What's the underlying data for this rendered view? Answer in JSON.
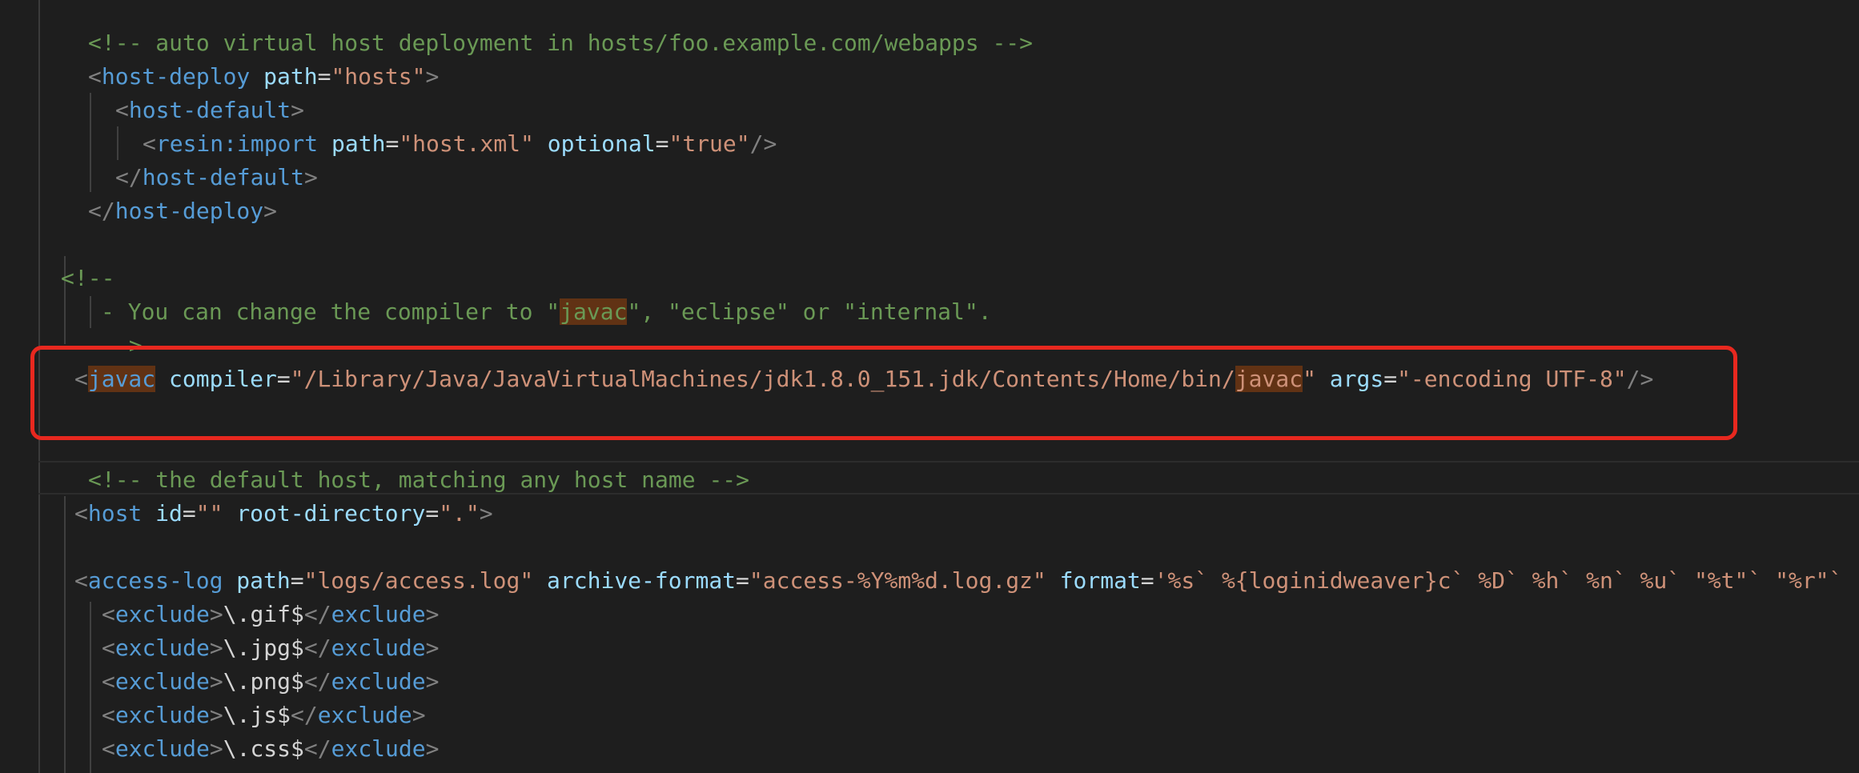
{
  "editor": {
    "lines": [
      {
        "id": "l1",
        "segments": [
          {
            "cls": "t-comment",
            "text": "<!-- auto virtual host deployment in hosts/foo.example.com/webapps -->"
          }
        ]
      },
      {
        "id": "l2",
        "segments": [
          {
            "cls": "t-bracket",
            "text": "<"
          },
          {
            "cls": "t-tag",
            "text": "host-deploy"
          },
          {
            "cls": "t-text",
            "text": " "
          },
          {
            "cls": "t-attr",
            "text": "path"
          },
          {
            "cls": "t-text",
            "text": "="
          },
          {
            "cls": "t-str",
            "text": "\"hosts\""
          },
          {
            "cls": "t-bracket",
            "text": ">"
          }
        ]
      },
      {
        "id": "l3",
        "segments": [
          {
            "cls": "t-bracket",
            "text": "<"
          },
          {
            "cls": "t-tag",
            "text": "host-default"
          },
          {
            "cls": "t-bracket",
            "text": ">"
          }
        ]
      },
      {
        "id": "l4",
        "segments": [
          {
            "cls": "t-bracket",
            "text": "<"
          },
          {
            "cls": "t-tag",
            "text": "resin:import"
          },
          {
            "cls": "t-text",
            "text": " "
          },
          {
            "cls": "t-attr",
            "text": "path"
          },
          {
            "cls": "t-text",
            "text": "="
          },
          {
            "cls": "t-str",
            "text": "\"host.xml\""
          },
          {
            "cls": "t-text",
            "text": " "
          },
          {
            "cls": "t-attr",
            "text": "optional"
          },
          {
            "cls": "t-text",
            "text": "="
          },
          {
            "cls": "t-str",
            "text": "\"true\""
          },
          {
            "cls": "t-bracket",
            "text": "/>"
          }
        ]
      },
      {
        "id": "l5",
        "segments": [
          {
            "cls": "t-bracket",
            "text": "</"
          },
          {
            "cls": "t-tag",
            "text": "host-default"
          },
          {
            "cls": "t-bracket",
            "text": ">"
          }
        ]
      },
      {
        "id": "l6",
        "segments": [
          {
            "cls": "t-bracket",
            "text": "</"
          },
          {
            "cls": "t-tag",
            "text": "host-deploy"
          },
          {
            "cls": "t-bracket",
            "text": ">"
          }
        ]
      },
      {
        "id": "l7",
        "segments": []
      },
      {
        "id": "l8",
        "segments": [
          {
            "cls": "t-comment",
            "text": "<!--"
          }
        ]
      },
      {
        "id": "l9",
        "segments": [
          {
            "cls": "t-comment",
            "text": "- You can change the compiler to \""
          },
          {
            "cls": "t-comment hl",
            "text": "javac"
          },
          {
            "cls": "t-comment",
            "text": "\", \"eclipse\" or \"internal\"."
          }
        ]
      },
      {
        "id": "l10",
        "segments": [
          {
            "cls": "t-comment",
            "text": "->"
          }
        ]
      },
      {
        "id": "l11",
        "segments": [
          {
            "cls": "t-bracket",
            "text": "<"
          },
          {
            "cls": "t-tag hl",
            "text": "javac"
          },
          {
            "cls": "t-text",
            "text": " "
          },
          {
            "cls": "t-attr",
            "text": "compiler"
          },
          {
            "cls": "t-text",
            "text": "="
          },
          {
            "cls": "t-str",
            "text": "\"/Library/Java/JavaVirtualMachines/jdk1.8.0_151.jdk/Contents/Home/bin/"
          },
          {
            "cls": "t-str hl",
            "text": "javac"
          },
          {
            "cls": "t-str",
            "text": "\""
          },
          {
            "cls": "t-text",
            "text": " "
          },
          {
            "cls": "t-attr",
            "text": "args"
          },
          {
            "cls": "t-text",
            "text": "="
          },
          {
            "cls": "t-str",
            "text": "\"-encoding UTF-8\""
          },
          {
            "cls": "t-bracket",
            "text": "/>"
          }
        ]
      },
      {
        "id": "l12",
        "segments": []
      },
      {
        "id": "l13",
        "segments": []
      },
      {
        "id": "l14",
        "segments": [
          {
            "cls": "t-comment",
            "text": "<!-- the default host, matching any host name -->"
          }
        ]
      },
      {
        "id": "l15",
        "segments": [
          {
            "cls": "t-bracket",
            "text": "<"
          },
          {
            "cls": "t-tag",
            "text": "host"
          },
          {
            "cls": "t-text",
            "text": " "
          },
          {
            "cls": "t-attr",
            "text": "id"
          },
          {
            "cls": "t-text",
            "text": "="
          },
          {
            "cls": "t-str",
            "text": "\"\""
          },
          {
            "cls": "t-text",
            "text": " "
          },
          {
            "cls": "t-attr",
            "text": "root-directory"
          },
          {
            "cls": "t-text",
            "text": "="
          },
          {
            "cls": "t-str",
            "text": "\".\""
          },
          {
            "cls": "t-bracket",
            "text": ">"
          }
        ]
      },
      {
        "id": "l16",
        "segments": []
      },
      {
        "id": "l17",
        "segments": [
          {
            "cls": "t-bracket",
            "text": "<"
          },
          {
            "cls": "t-tag",
            "text": "access-log"
          },
          {
            "cls": "t-text",
            "text": " "
          },
          {
            "cls": "t-attr",
            "text": "path"
          },
          {
            "cls": "t-text",
            "text": "="
          },
          {
            "cls": "t-str",
            "text": "\"logs/access.log\""
          },
          {
            "cls": "t-text",
            "text": " "
          },
          {
            "cls": "t-attr",
            "text": "archive-format"
          },
          {
            "cls": "t-text",
            "text": "="
          },
          {
            "cls": "t-str",
            "text": "\"access-%Y%m%d.log.gz\""
          },
          {
            "cls": "t-text",
            "text": " "
          },
          {
            "cls": "t-attr",
            "text": "format"
          },
          {
            "cls": "t-text",
            "text": "="
          },
          {
            "cls": "t-str",
            "text": "'%s` %{loginidweaver}c` %D` %h` %n` %u` \"%t\"` \"%r\"`"
          }
        ]
      },
      {
        "id": "l18",
        "segments": [
          {
            "cls": "t-bracket",
            "text": "<"
          },
          {
            "cls": "t-tag",
            "text": "exclude"
          },
          {
            "cls": "t-bracket",
            "text": ">"
          },
          {
            "cls": "t-text",
            "text": "\\.gif$"
          },
          {
            "cls": "t-bracket",
            "text": "</"
          },
          {
            "cls": "t-tag",
            "text": "exclude"
          },
          {
            "cls": "t-bracket",
            "text": ">"
          }
        ]
      },
      {
        "id": "l19",
        "segments": [
          {
            "cls": "t-bracket",
            "text": "<"
          },
          {
            "cls": "t-tag",
            "text": "exclude"
          },
          {
            "cls": "t-bracket",
            "text": ">"
          },
          {
            "cls": "t-text",
            "text": "\\.jpg$"
          },
          {
            "cls": "t-bracket",
            "text": "</"
          },
          {
            "cls": "t-tag",
            "text": "exclude"
          },
          {
            "cls": "t-bracket",
            "text": ">"
          }
        ]
      },
      {
        "id": "l20",
        "segments": [
          {
            "cls": "t-bracket",
            "text": "<"
          },
          {
            "cls": "t-tag",
            "text": "exclude"
          },
          {
            "cls": "t-bracket",
            "text": ">"
          },
          {
            "cls": "t-text",
            "text": "\\.png$"
          },
          {
            "cls": "t-bracket",
            "text": "</"
          },
          {
            "cls": "t-tag",
            "text": "exclude"
          },
          {
            "cls": "t-bracket",
            "text": ">"
          }
        ]
      },
      {
        "id": "l21",
        "segments": [
          {
            "cls": "t-bracket",
            "text": "<"
          },
          {
            "cls": "t-tag",
            "text": "exclude"
          },
          {
            "cls": "t-bracket",
            "text": ">"
          },
          {
            "cls": "t-text",
            "text": "\\.js$"
          },
          {
            "cls": "t-bracket",
            "text": "</"
          },
          {
            "cls": "t-tag",
            "text": "exclude"
          },
          {
            "cls": "t-bracket",
            "text": ">"
          }
        ]
      },
      {
        "id": "l22",
        "segments": [
          {
            "cls": "t-bracket",
            "text": "<"
          },
          {
            "cls": "t-tag",
            "text": "exclude"
          },
          {
            "cls": "t-bracket",
            "text": ">"
          },
          {
            "cls": "t-text",
            "text": "\\.css$"
          },
          {
            "cls": "t-bracket",
            "text": "</"
          },
          {
            "cls": "t-tag",
            "text": "exclude"
          },
          {
            "cls": "t-bracket",
            "text": ">"
          }
        ]
      }
    ]
  },
  "colors": {
    "background": "#1e1e1e",
    "comment": "#6a9955",
    "tag": "#569cd6",
    "attribute": "#9cdcfe",
    "string": "#ce9178",
    "bracket": "#808080",
    "highlight": "#613214",
    "annotation_box": "#e8281f"
  }
}
